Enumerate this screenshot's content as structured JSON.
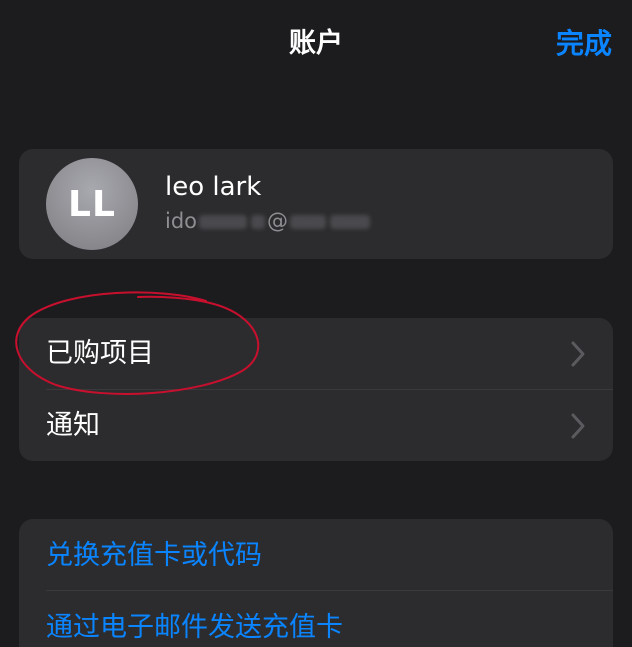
{
  "header": {
    "title": "账户",
    "done_label": "完成"
  },
  "profile": {
    "initials": "LL",
    "name": "leo lark",
    "email_visible_prefix": "ido",
    "email_at": "@"
  },
  "menu": {
    "items": [
      {
        "label": "已购项目"
      },
      {
        "label": "通知"
      }
    ]
  },
  "links": {
    "items": [
      {
        "label": "兑换充值卡或代码"
      },
      {
        "label": "通过电子邮件发送充值卡"
      }
    ]
  },
  "colors": {
    "background": "#1c1c1e",
    "card": "#2c2c2e",
    "accent": "#0a84ff",
    "annotation": "#c8102e"
  }
}
